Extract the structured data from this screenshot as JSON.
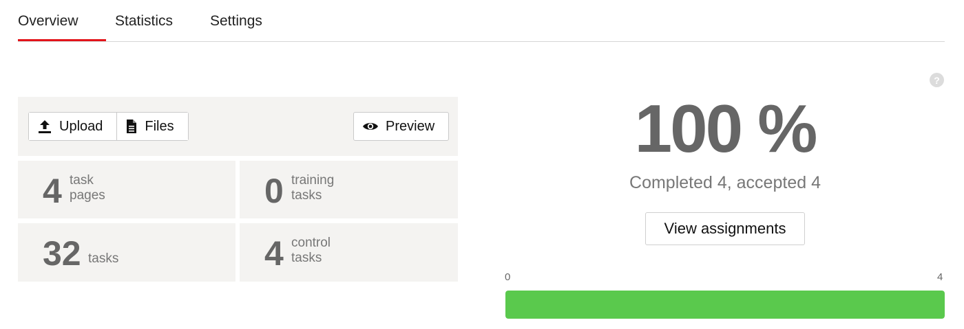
{
  "tabs": [
    {
      "label": "Overview",
      "active": true
    },
    {
      "label": "Statistics",
      "active": false
    },
    {
      "label": "Settings",
      "active": false
    }
  ],
  "toolbar": {
    "upload_label": "Upload",
    "files_label": "Files",
    "preview_label": "Preview"
  },
  "stats": {
    "task_pages": {
      "value": "4",
      "label_line1": "task",
      "label_line2": "pages"
    },
    "training_tasks": {
      "value": "0",
      "label_line1": "training",
      "label_line2": "tasks"
    },
    "tasks": {
      "value": "32",
      "label": "tasks"
    },
    "control_tasks": {
      "value": "4",
      "label_line1": "control",
      "label_line2": "tasks"
    }
  },
  "progress": {
    "percent_text": "100 %",
    "summary": "Completed 4, accepted 4",
    "view_assignments_label": "View assignments",
    "scale_min": "0",
    "scale_max": "4",
    "fill_fraction": 1.0,
    "help_icon": "question-icon",
    "help_glyph": "?"
  },
  "colors": {
    "accent": "#e3141a",
    "progress_fill": "#5ac94d",
    "panel_bg": "#f4f3f1"
  }
}
